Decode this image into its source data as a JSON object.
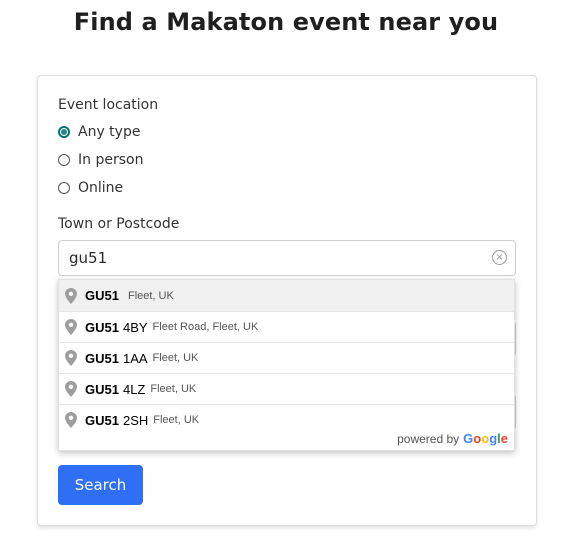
{
  "page": {
    "title": "Find a Makaton event near you"
  },
  "form": {
    "event_location_label": "Event location",
    "radio_options": [
      {
        "label": "Any type",
        "checked": true
      },
      {
        "label": "In person",
        "checked": false
      },
      {
        "label": "Online",
        "checked": false
      }
    ],
    "town_label": "Town or Postcode",
    "town_value": "gu51",
    "clear_icon": "×",
    "search_label": "Search"
  },
  "autocomplete": {
    "suggestions": [
      {
        "match": "GU51",
        "rest": "",
        "secondary": "Fleet, UK"
      },
      {
        "match": "GU51",
        "rest": "4BY",
        "secondary": "Fleet Road, Fleet, UK"
      },
      {
        "match": "GU51",
        "rest": "1AA",
        "secondary": "Fleet, UK"
      },
      {
        "match": "GU51",
        "rest": "4LZ",
        "secondary": "Fleet, UK"
      },
      {
        "match": "GU51",
        "rest": "2SH",
        "secondary": "Fleet, UK"
      }
    ],
    "powered_by": "powered by",
    "google_letters": [
      "G",
      "o",
      "o",
      "g",
      "l",
      "e"
    ]
  },
  "colors": {
    "accent": "#2f6ff4",
    "radio_checked": "#1a8a8a"
  }
}
